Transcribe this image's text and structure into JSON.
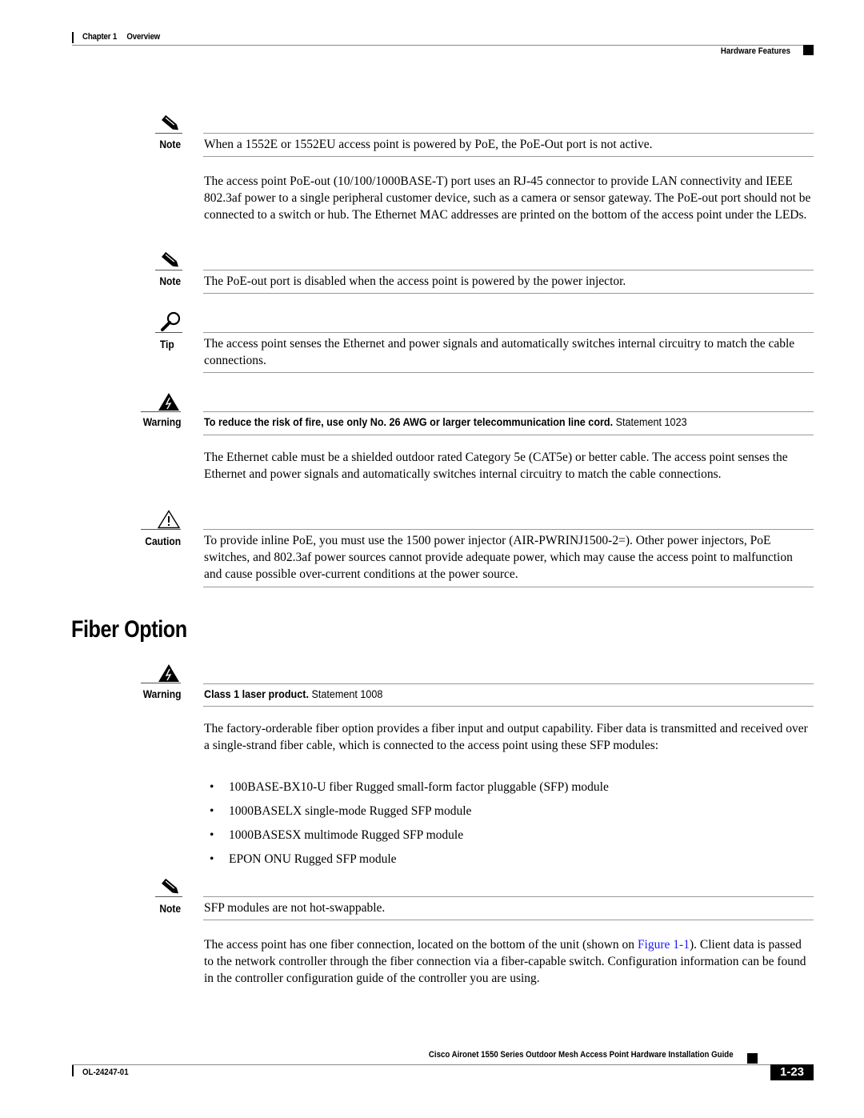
{
  "header": {
    "chapter": "Chapter 1",
    "chapter_title": "Overview",
    "section": "Hardware Features"
  },
  "blocks": {
    "note1": {
      "label": "Note",
      "icon": "pencil-icon",
      "text": "When a 1552E or 1552EU access point is powered by PoE, the PoE-Out port is not active."
    },
    "para1": "The access point PoE-out (10/100/1000BASE-T) port uses an RJ-45 connector to provide LAN connectivity and IEEE 802.3af power to a single peripheral customer device, such as a camera or sensor gateway. The PoE-out port should not be connected to a switch or hub. The Ethernet MAC addresses are printed on the bottom of the access point under the LEDs.",
    "note2": {
      "label": "Note",
      "icon": "pencil-icon",
      "text": "The PoE-out port is disabled when the access point is powered by the power injector."
    },
    "tip1": {
      "label": "Tip",
      "icon": "magnifier-icon",
      "text": "The access point senses the Ethernet and power signals and automatically switches internal circuitry to match the cable connections."
    },
    "warning1": {
      "label": "Warning",
      "icon": "warning-lightning-icon",
      "text_bold": "To reduce the risk of fire, use only No. 26 AWG or larger telecommunication line cord.",
      "statement": "Statement 1023"
    },
    "para2": "The Ethernet cable must be a shielded outdoor rated Category 5e (CAT5e) or better cable. The access point senses the Ethernet and power signals and automatically switches internal circuitry to match the cable connections.",
    "caution1": {
      "label": "Caution",
      "icon": "caution-triangle-icon",
      "text": "To provide inline PoE, you must use the 1500 power injector (AIR-PWRINJ1500-2=). Other power injectors, PoE switches, and 802.3af power sources cannot provide adequate power, which may cause the access point to malfunction and cause possible over-current conditions at the power source."
    },
    "heading": "Fiber Option",
    "warning2": {
      "label": "Warning",
      "icon": "warning-lightning-icon",
      "text_bold": "Class 1 laser product.",
      "statement": "Statement 1008"
    },
    "para3": "The factory-orderable fiber option provides a fiber input and output capability. Fiber data is transmitted and received over a single-strand fiber cable, which is connected to the access point using these SFP modules:",
    "bullets": [
      "100BASE-BX10-U fiber Rugged small-form factor pluggable (SFP) module",
      "1000BASELX single-mode Rugged SFP module",
      "1000BASESX multimode Rugged SFP module",
      "EPON ONU Rugged SFP module"
    ],
    "note3": {
      "label": "Note",
      "icon": "pencil-icon",
      "text": "SFP modules are not hot-swappable."
    },
    "para4": {
      "before_link": "The access point has one fiber connection, located on the bottom of the unit (shown on ",
      "link": "Figure 1-1",
      "after_link": "). Client data is passed to the network controller through the fiber connection via a fiber-capable switch. Configuration information can be found in the controller configuration guide of the controller you are using."
    }
  },
  "footer": {
    "guide_title": "Cisco Aironet 1550 Series Outdoor Mesh Access Point Hardware Installation Guide",
    "doc_number": "OL-24247-01",
    "page_number": "1-23"
  },
  "colors": {
    "link": "#1a1aff",
    "rule": "#999999"
  }
}
